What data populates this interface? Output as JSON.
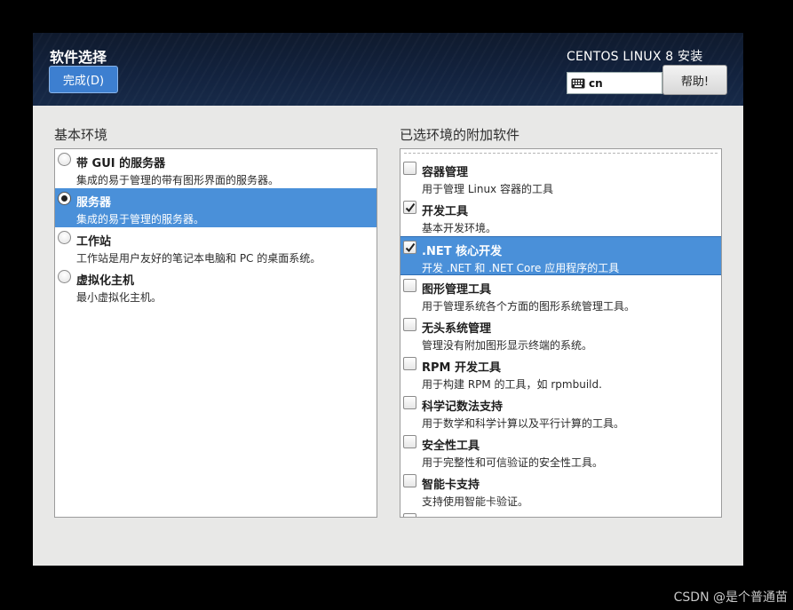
{
  "header": {
    "title": "软件选择",
    "done_label": "完成(D)",
    "product": "CENTOS LINUX 8 安装",
    "keyboard_layout": "cn",
    "help_label": "帮助!"
  },
  "left": {
    "label": "基本环境",
    "items": [
      {
        "title": "带 GUI 的服务器",
        "desc": "集成的易于管理的带有图形界面的服务器。",
        "selected": false
      },
      {
        "title": "服务器",
        "desc": "集成的易于管理的服务器。",
        "selected": true
      },
      {
        "title": "工作站",
        "desc": "工作站是用户友好的笔记本电脑和 PC 的桌面系统。",
        "selected": false
      },
      {
        "title": "虚拟化主机",
        "desc": "最小虚拟化主机。",
        "selected": false
      }
    ]
  },
  "right": {
    "label": "已选环境的附加软件",
    "items": [
      {
        "title": "容器管理",
        "desc": "用于管理 Linux 容器的工具",
        "checked": false,
        "selected": false
      },
      {
        "title": "开发工具",
        "desc": "基本开发环境。",
        "checked": true,
        "selected": false
      },
      {
        "title": ".NET 核心开发",
        "desc": "开发 .NET 和 .NET Core 应用程序的工具",
        "checked": true,
        "selected": true
      },
      {
        "title": "图形管理工具",
        "desc": "用于管理系统各个方面的图形系统管理工具。",
        "checked": false,
        "selected": false
      },
      {
        "title": "无头系统管理",
        "desc": "管理没有附加图形显示终端的系统。",
        "checked": false,
        "selected": false
      },
      {
        "title": "RPM 开发工具",
        "desc": "用于构建 RPM 的工具，如 rpmbuild.",
        "checked": false,
        "selected": false
      },
      {
        "title": "科学记数法支持",
        "desc": "用于数学和科学计算以及平行计算的工具。",
        "checked": false,
        "selected": false
      },
      {
        "title": "安全性工具",
        "desc": "用于完整性和可信验证的安全性工具。",
        "checked": false,
        "selected": false
      },
      {
        "title": "智能卡支持",
        "desc": "支持使用智能卡验证。",
        "checked": false,
        "selected": false
      }
    ]
  },
  "watermark": "CSDN @是个普通苗",
  "icons": {
    "keyboard": "keyboard-icon",
    "radio": "radio-button",
    "checkbox": "checkbox-icon"
  },
  "colors": {
    "selection": "#4a90d9",
    "done_button": "#3d7fd0",
    "header_bg": "#13233f"
  }
}
